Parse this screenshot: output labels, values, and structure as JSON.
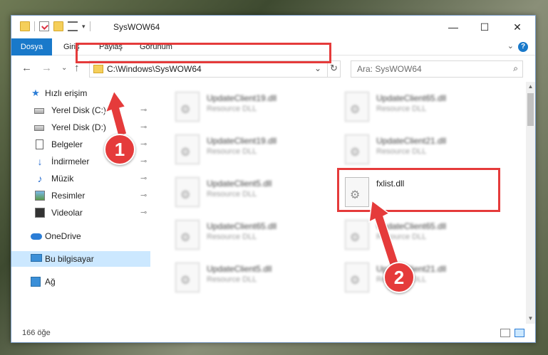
{
  "window": {
    "title": "SysWOW64",
    "minimize": "—",
    "maximize": "☐",
    "close": "✕"
  },
  "ribbon": {
    "tabs": [
      "Dosya",
      "Giriş",
      "Paylaş",
      "Görünüm"
    ],
    "help": "?",
    "expand": "⌄"
  },
  "address": {
    "path": "C:\\Windows\\SysWOW64",
    "dropdown": "⌄",
    "refresh": "↻",
    "back": "←",
    "forward": "→",
    "recent": "⌄",
    "up": "↑"
  },
  "search": {
    "placeholder": "Ara: SysWOW64",
    "icon": "search-icon"
  },
  "sidebar": {
    "items": [
      {
        "label": "Hızlı erişim",
        "icon": "star-icon"
      },
      {
        "label": "Yerel Disk (C:)",
        "icon": "disk-icon",
        "pinned": true
      },
      {
        "label": "Yerel Disk (D:)",
        "icon": "disk-icon",
        "pinned": true
      },
      {
        "label": "Belgeler",
        "icon": "document-icon",
        "pinned": true
      },
      {
        "label": "İndirmeler",
        "icon": "download-icon",
        "pinned": true
      },
      {
        "label": "Müzik",
        "icon": "music-icon",
        "pinned": true
      },
      {
        "label": "Resimler",
        "icon": "pictures-icon",
        "pinned": true
      },
      {
        "label": "Videolar",
        "icon": "video-icon",
        "pinned": true
      },
      {
        "label": "OneDrive",
        "icon": "cloud-icon"
      },
      {
        "label": "Bu bilgisayar",
        "icon": "computer-icon",
        "selected": true
      },
      {
        "label": "Ağ",
        "icon": "network-icon"
      }
    ],
    "pin_glyph": "📌"
  },
  "files": {
    "left_column": [
      {
        "name": "UpdateClient19.dll",
        "type": "Resource DLL"
      },
      {
        "name": "UpdateClient19.dll",
        "type": "Resource DLL"
      },
      {
        "name": "UpdateClient5.dll",
        "type": "Resource DLL"
      },
      {
        "name": "UpdateClient65.dll",
        "type": "Resource DLL"
      },
      {
        "name": "UpdateClient5.dll",
        "type": "Resource DLL"
      }
    ],
    "right_column": [
      {
        "name": "UpdateClient65.dll",
        "type": "Resource DLL"
      },
      {
        "name": "UpdateClient21.dll",
        "type": "Resource DLL"
      },
      {
        "name": "fxlist.dll",
        "type": ""
      },
      {
        "name": "UpdateClient65.dll",
        "type": "Resource DLL"
      },
      {
        "name": "UpdateClient21.dll",
        "type": "Resource DLL"
      }
    ]
  },
  "status": {
    "count": "166 öğe"
  },
  "annotations": {
    "step1": "1",
    "step2": "2",
    "color": "#e53b3b"
  }
}
